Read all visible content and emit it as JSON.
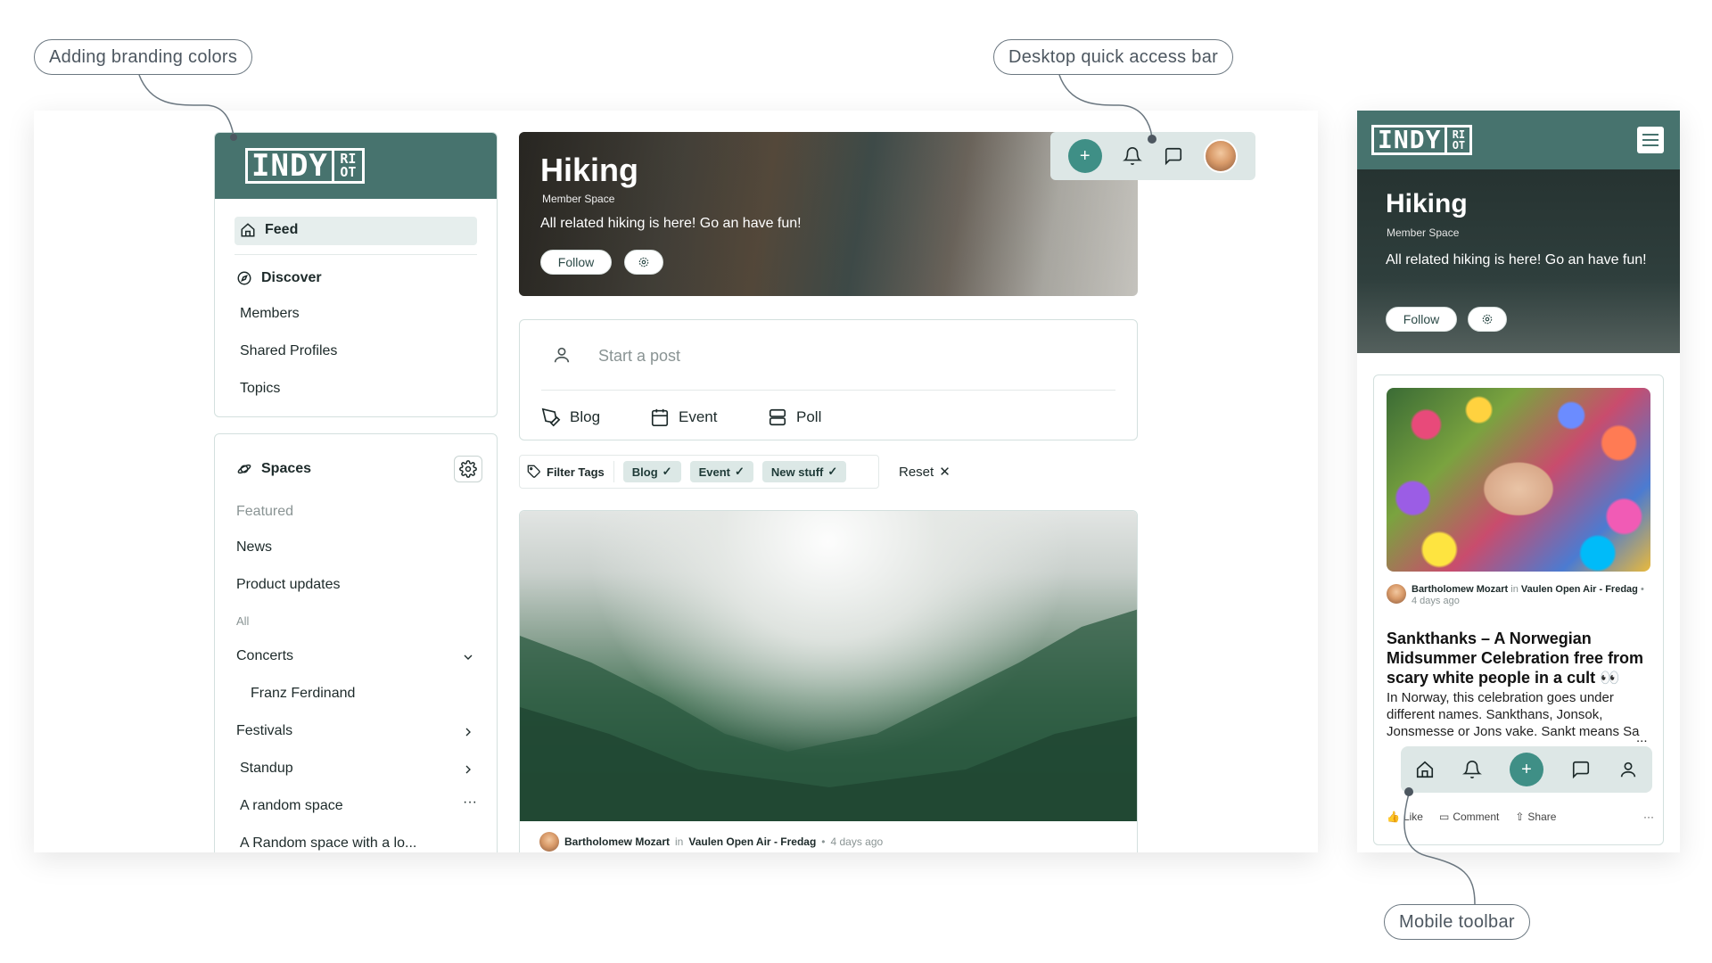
{
  "callouts": {
    "branding": "Adding branding colors",
    "quick_bar": "Desktop quick access bar",
    "mobile_toolbar": "Mobile toolbar"
  },
  "brand": {
    "logo_main": "INDY",
    "logo_box": [
      "RI",
      "OT"
    ],
    "accent": "#47736e",
    "accent_button": "#3f8f86"
  },
  "sidebar": {
    "feed": "Feed",
    "discover": "Discover",
    "discover_items": [
      "Members",
      "Shared Profiles",
      "Topics"
    ],
    "spaces_title": "Spaces",
    "featured_label": "Featured",
    "featured_items": [
      "News",
      "Product updates"
    ],
    "all_label": "All",
    "concerts": "Concerts",
    "concerts_child": "Franz Ferdinand",
    "festivals": "Festivals",
    "standup": "Standup",
    "random_space": "A random space",
    "random_space_long": "A Random space with a lo..."
  },
  "hero": {
    "title": "Hiking",
    "subtitle": "Member Space",
    "description": "All related hiking is here! Go an have fun!",
    "follow": "Follow"
  },
  "composer": {
    "placeholder": "Start a post",
    "blog": "Blog",
    "event": "Event",
    "poll": "Poll"
  },
  "filters": {
    "filter_tags": "Filter Tags",
    "tags": [
      "Blog",
      "Event",
      "New stuff"
    ],
    "reset": "Reset"
  },
  "post": {
    "author": "Bartholomew Mozart",
    "in_word": "in",
    "space": "Vaulen Open Air - Fredag",
    "time": "4 days ago"
  },
  "mobile": {
    "hero_title": "Hiking",
    "hero_subtitle": "Member Space",
    "hero_description": "All related hiking is here! Go an have fun!",
    "follow": "Follow",
    "post_author": "Bartholomew Mozart",
    "post_in": "in",
    "post_space": "Vaulen Open Air - Fredag",
    "post_time": "4 days ago",
    "post_title": "Sankthanks – A Norwegian Midsummer Celebration free from scary white people in a cult 👀",
    "post_body": "In Norway, this celebration goes under different names. Sankthans, Jonsok, Jonsmesse or Jons vake. Sankt means Sa",
    "ellipsis": "...",
    "like": "Like",
    "comment": "Comment",
    "share": "Share",
    "more": "···"
  }
}
